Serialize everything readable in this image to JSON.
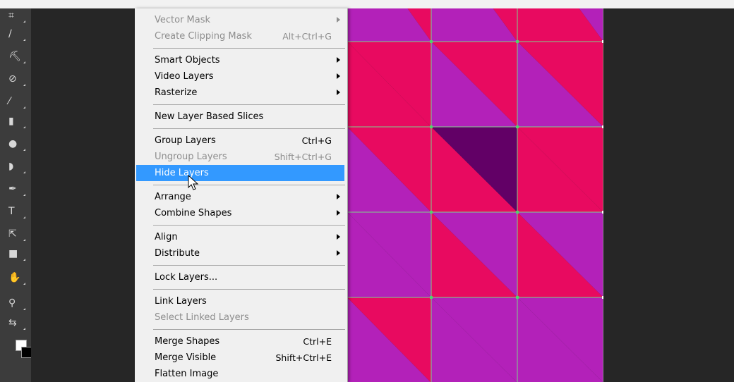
{
  "colors": {
    "magenta": "#e80a60",
    "purple": "#b321b9",
    "dark_purple": "#620066",
    "guide": "#7fd08a",
    "menu_bg": "#f0f0f0",
    "menu_highlight": "#3399ff",
    "disabled_text": "#8d8d8d"
  },
  "toolbar": {
    "tools": [
      {
        "name": "crop-tool-icon",
        "glyph": "⌗"
      },
      {
        "name": "eyedropper-tool-icon",
        "glyph": "∕"
      },
      {
        "name": "spot-healing-tool-icon",
        "glyph": "⛏"
      },
      {
        "name": "brush-tool-icon",
        "glyph": "⊘"
      },
      {
        "name": "clone-stamp-tool-icon",
        "glyph": "⁄"
      },
      {
        "name": "eraser-tool-icon",
        "glyph": "▮"
      },
      {
        "name": "gradient-tool-icon",
        "glyph": "●"
      },
      {
        "name": "blur-tool-icon",
        "glyph": "◗"
      },
      {
        "name": "pen-tool-icon",
        "glyph": "✒"
      },
      {
        "name": "type-tool-icon",
        "glyph": "T"
      },
      {
        "name": "path-selection-tool-icon",
        "glyph": "⇱"
      },
      {
        "name": "shape-tool-icon",
        "glyph": "■"
      },
      {
        "name": "hand-tool-icon",
        "glyph": "✋"
      },
      {
        "name": "zoom-tool-icon",
        "glyph": "⚲"
      },
      {
        "name": "swap-colors-icon",
        "glyph": "⇆"
      }
    ],
    "foreground_color": "#ffffff",
    "background_color": "#000000"
  },
  "menu": {
    "items": [
      {
        "label": "Vector Mask",
        "shortcut": "",
        "submenu": true,
        "disabled": true
      },
      {
        "label": "Create Clipping Mask",
        "shortcut": "Alt+Ctrl+G",
        "submenu": false,
        "disabled": true
      },
      {
        "separator": true
      },
      {
        "label": "Smart Objects",
        "shortcut": "",
        "submenu": true,
        "disabled": false
      },
      {
        "label": "Video Layers",
        "shortcut": "",
        "submenu": true,
        "disabled": false
      },
      {
        "label": "Rasterize",
        "shortcut": "",
        "submenu": true,
        "disabled": false
      },
      {
        "separator": true
      },
      {
        "label": "New Layer Based Slices",
        "shortcut": "",
        "submenu": false,
        "disabled": false
      },
      {
        "separator": true
      },
      {
        "label": "Group Layers",
        "shortcut": "Ctrl+G",
        "submenu": false,
        "disabled": false
      },
      {
        "label": "Ungroup Layers",
        "shortcut": "Shift+Ctrl+G",
        "submenu": false,
        "disabled": true
      },
      {
        "label": "Hide Layers",
        "shortcut": "",
        "submenu": false,
        "disabled": false,
        "highlighted": true
      },
      {
        "separator": true
      },
      {
        "label": "Arrange",
        "shortcut": "",
        "submenu": true,
        "disabled": false
      },
      {
        "label": "Combine Shapes",
        "shortcut": "",
        "submenu": true,
        "disabled": false
      },
      {
        "separator": true
      },
      {
        "label": "Align",
        "shortcut": "",
        "submenu": true,
        "disabled": false
      },
      {
        "label": "Distribute",
        "shortcut": "",
        "submenu": true,
        "disabled": false
      },
      {
        "separator": true
      },
      {
        "label": "Lock Layers...",
        "shortcut": "",
        "submenu": false,
        "disabled": false
      },
      {
        "separator": true
      },
      {
        "label": "Link Layers",
        "shortcut": "",
        "submenu": false,
        "disabled": false
      },
      {
        "label": "Select Linked Layers",
        "shortcut": "",
        "submenu": false,
        "disabled": true
      },
      {
        "separator": true
      },
      {
        "label": "Merge Shapes",
        "shortcut": "Ctrl+E",
        "submenu": false,
        "disabled": false
      },
      {
        "label": "Merge Visible",
        "shortcut": "Shift+Ctrl+E",
        "submenu": false,
        "disabled": false
      },
      {
        "label": "Flatten Image",
        "shortcut": "",
        "submenu": false,
        "disabled": false
      }
    ]
  }
}
